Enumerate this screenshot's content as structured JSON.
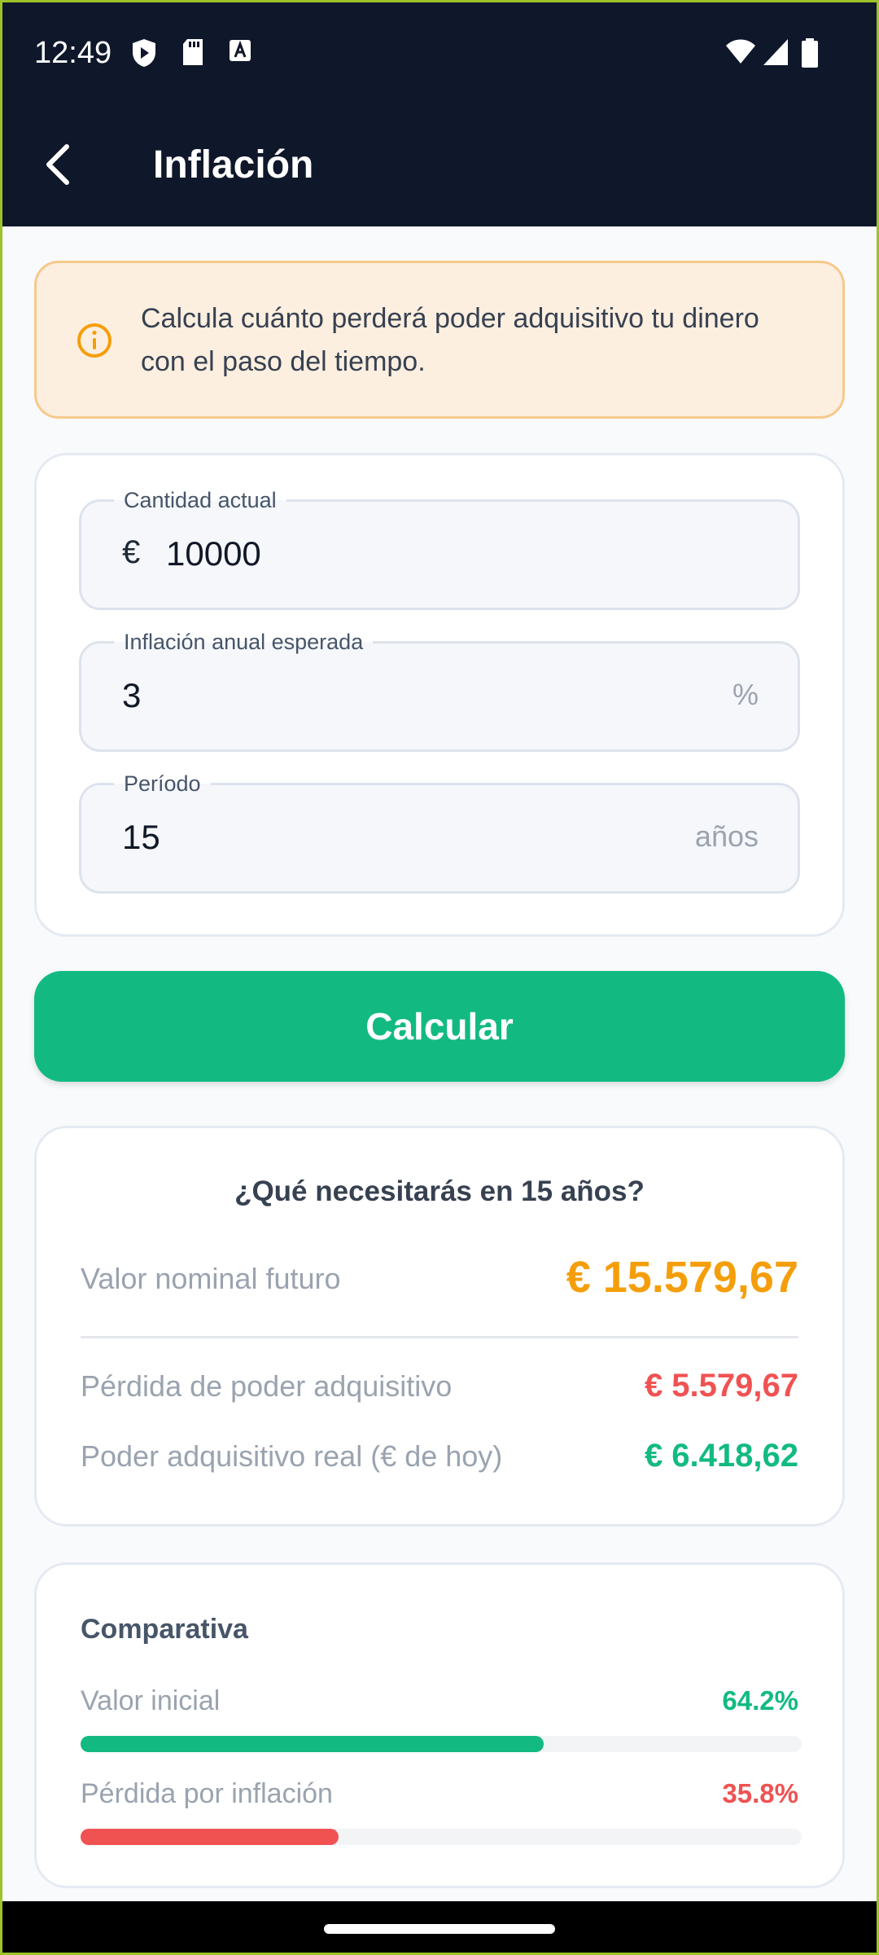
{
  "status_bar": {
    "time": "12:49"
  },
  "app_bar": {
    "title": "Inflación"
  },
  "info": {
    "text": "Calcula cuánto perderá poder adquisitivo tu dinero con el paso del tiempo."
  },
  "form": {
    "amount": {
      "label": "Cantidad actual",
      "prefix": "€",
      "value": "10000"
    },
    "inflation": {
      "label": "Inflación anual esperada",
      "value": "3",
      "suffix": "%"
    },
    "period": {
      "label": "Período",
      "value": "15",
      "suffix": "años"
    }
  },
  "calc_button": {
    "label": "Calcular"
  },
  "results": {
    "title": "¿Qué necesitarás en 15 años?",
    "nominal_label": "Valor nominal futuro",
    "nominal_value": "€ 15.579,67",
    "loss_label": "Pérdida de poder adquisitivo",
    "loss_value": "€ 5.579,67",
    "real_label": "Poder adquisitivo real (€ de hoy)",
    "real_value": "€ 6.418,62"
  },
  "comparison": {
    "title": "Comparativa",
    "initial_label": "Valor inicial",
    "initial_pct": "64.2%",
    "initial_fraction": 0.642,
    "loss_label": "Pérdida por inflación",
    "loss_pct": "35.8%",
    "loss_fraction": 0.358
  },
  "colors": {
    "dark": "#0F172A",
    "green": "#12BA82",
    "orange": "#F59E0B",
    "red": "#F05252",
    "info_bg": "#FCEFE0"
  }
}
